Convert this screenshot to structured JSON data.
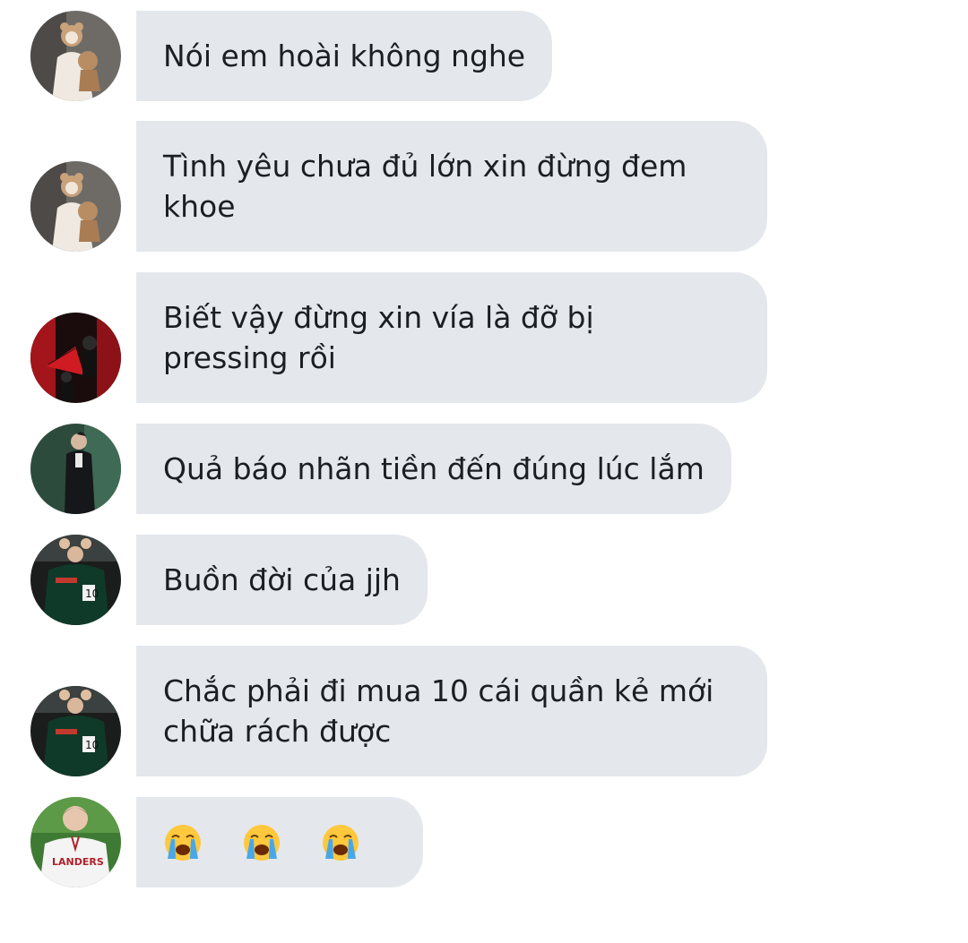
{
  "chat": {
    "messages": [
      {
        "avatar": "avatar-girl-with-teddy",
        "text": "Nói em hoài không nghe"
      },
      {
        "avatar": "avatar-girl-with-teddy",
        "text": "Tình yêu chưa đủ lớn xin đừng đem khoe"
      },
      {
        "avatar": "avatar-red-fan",
        "text": "Biết vậy đừng xin vía là đỡ bị pressing rồi"
      },
      {
        "avatar": "avatar-man-in-suit",
        "text": "Quả báo nhãn tiền đến đúng lúc lắm"
      },
      {
        "avatar": "avatar-jersey-10",
        "text": "Buồn đời của jjh"
      },
      {
        "avatar": "avatar-jersey-10",
        "text": "Chắc phải đi mua 10 cái quần kẻ mới chữa rách được"
      },
      {
        "avatar": "avatar-baseball-jersey",
        "emoji": [
          "loudly-crying-face",
          "loudly-crying-face",
          "loudly-crying-face"
        ]
      }
    ]
  },
  "colors": {
    "bubble_background": "#e4e8ed",
    "text": "#1c1e21",
    "page_background": "#ffffff"
  }
}
